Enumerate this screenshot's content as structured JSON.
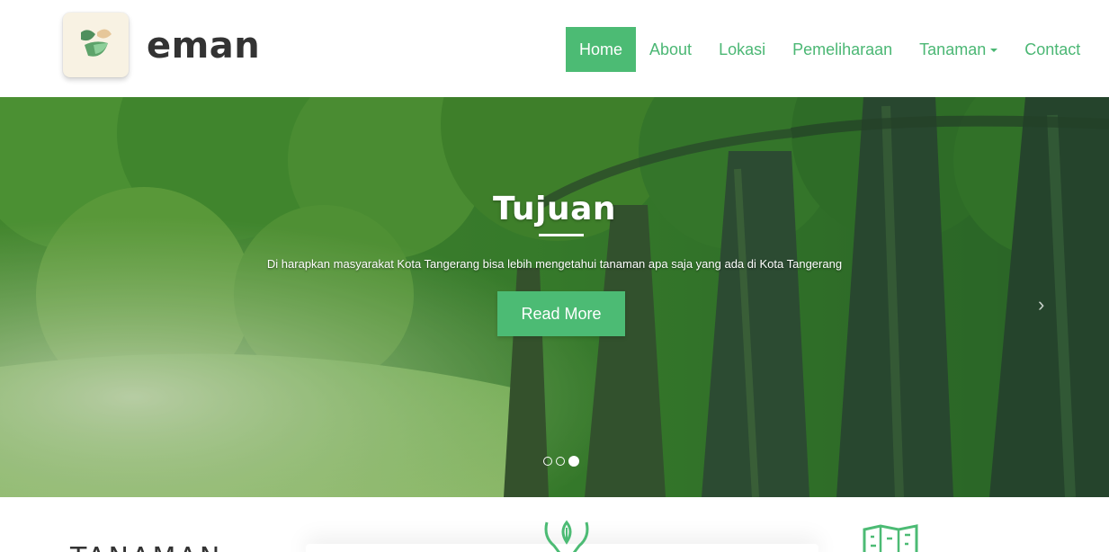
{
  "brand": {
    "name": "eman",
    "logo_icon": "leaf-logo-icon",
    "colors": {
      "tile": "#f8f2e3",
      "leaf_dark": "#4f8f5d",
      "leaf_light": "#8ecf9a",
      "leaf_tan": "#e6c79a"
    }
  },
  "nav": {
    "items": [
      {
        "label": "Home",
        "active": true
      },
      {
        "label": "About"
      },
      {
        "label": "Lokasi"
      },
      {
        "label": "Pemeliharaan"
      },
      {
        "label": "Tanaman",
        "dropdown": true
      },
      {
        "label": "Contact"
      }
    ]
  },
  "hero": {
    "title": "Tujuan",
    "text": "Di harapkan masyarakat Kota Tangerang bisa lebih mengetahui tanaman apa saja yang ada di Kota Tangerang",
    "button": "Read More",
    "next_glyph": "›",
    "slides": 3,
    "active_slide": 3
  },
  "section": {
    "title": "TANAMAN",
    "icons": [
      "hands-leaf-icon",
      "map-icon"
    ]
  },
  "colors": {
    "accent": "#4cbb74",
    "nav_text": "#4bb774",
    "brand_text": "#333333"
  }
}
